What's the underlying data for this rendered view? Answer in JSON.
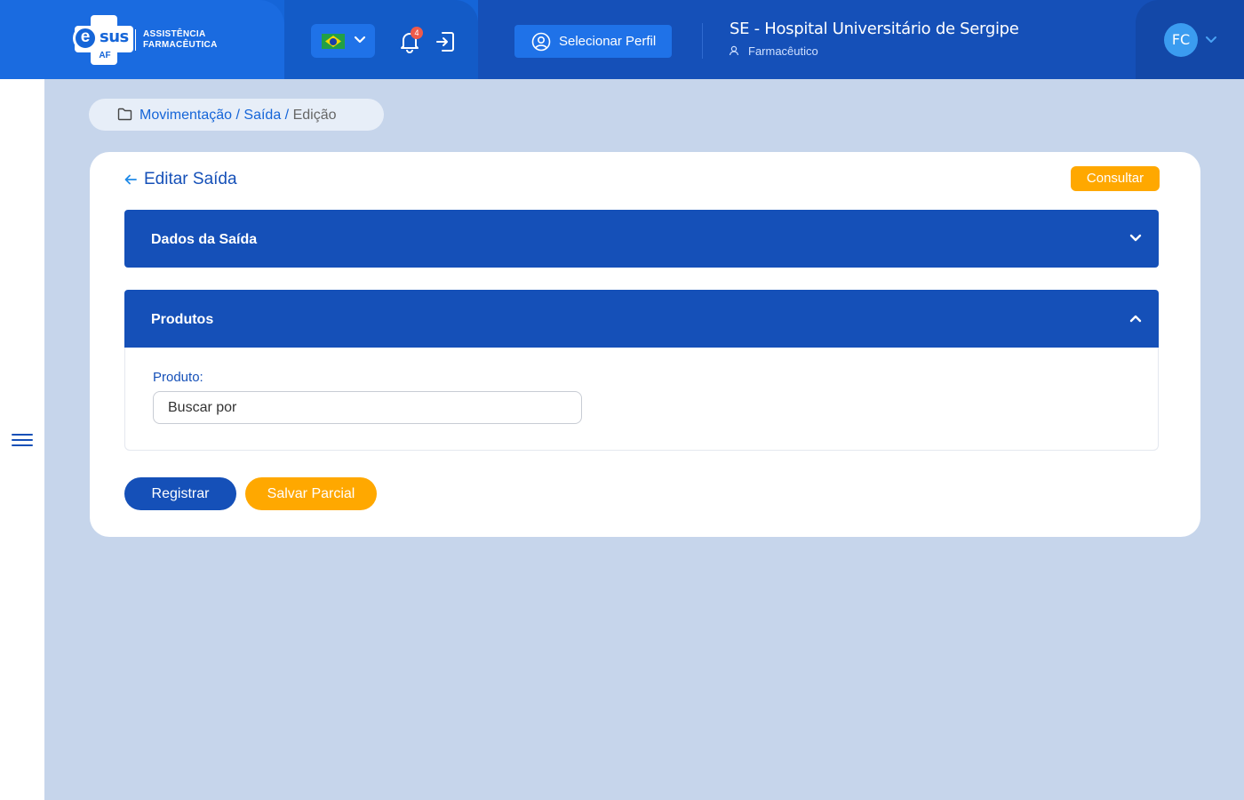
{
  "header": {
    "logo": {
      "e": "e",
      "sus": "sus",
      "af": "AF",
      "line1": "ASSISTÊNCIA",
      "line2": "FARMACÊUTICA"
    },
    "language_flag": "brazil-flag",
    "notification_count": "4",
    "profile_button_label": "Selecionar Perfil",
    "hospital_name": "SE - Hospital Universitário de Sergipe",
    "user_role": "Farmacêutico",
    "avatar_initials": "FC",
    "colors": {
      "primary": "#1565d8",
      "dark": "#1550b8",
      "badge": "#ef5a4a"
    }
  },
  "breadcrumb": {
    "item1": "Movimentação",
    "item2": "Saída",
    "current": "Edição",
    "separator": "/"
  },
  "card": {
    "title": "Editar Saída",
    "consult_button": "Consultar",
    "panels": [
      {
        "title": "Dados da Saída",
        "expanded": false
      },
      {
        "title": "Produtos",
        "expanded": true
      }
    ],
    "product_field": {
      "label": "Produto:",
      "placeholder": "Buscar por",
      "value": ""
    },
    "register_button": "Registrar",
    "partial_save_button": "Salvar Parcial",
    "colors": {
      "accent": "#ffa800"
    }
  }
}
